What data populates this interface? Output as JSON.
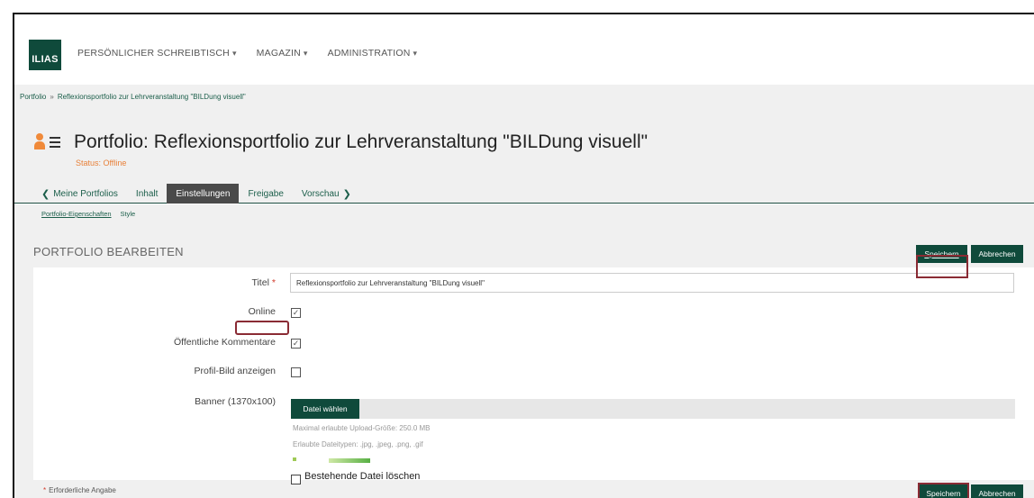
{
  "app": {
    "logo_text": "ILIAS"
  },
  "mainnav": {
    "items": [
      {
        "label": "PERSÖNLICHER SCHREIBTISCH",
        "caret": "▾"
      },
      {
        "label": "MAGAZIN",
        "caret": "▾"
      },
      {
        "label": "ADMINISTRATION",
        "caret": "▾"
      }
    ]
  },
  "breadcrumb": {
    "items": [
      "Portfolio",
      "Reflexionsportfolio zur Lehrveranstaltung \"BILDung visuell\""
    ],
    "separator": "»"
  },
  "header": {
    "title": "Portfolio: Reflexionsportfolio zur Lehrveranstaltung \"BILDung visuell\"",
    "status": "Status: Offline",
    "icon": "portfolio-icon"
  },
  "tabs": {
    "back_label": "Meine Portfolios",
    "items": [
      "Inhalt",
      "Einstellungen",
      "Freigabe"
    ],
    "active": "Einstellungen",
    "forward_label": "Vorschau"
  },
  "subtabs": {
    "items": [
      "Portfolio-Eigenschaften",
      "Style"
    ],
    "active": "Portfolio-Eigenschaften"
  },
  "form": {
    "heading": "PORTFOLIO BEARBEITEN",
    "save_label": "Speichern",
    "cancel_label": "Abbrechen",
    "fields": {
      "title_label": "Titel",
      "title_required_mark": "*",
      "title_value": "Reflexionsportfolio zur Lehrveranstaltung \"BILDung visuell\"",
      "online_label": "Online",
      "online_checked": true,
      "comments_label": "Öffentliche Kommentare",
      "comments_checked": true,
      "profile_pic_label": "Profil-Bild anzeigen",
      "profile_pic_checked": false,
      "banner_label": "Banner (1370x100)",
      "file_button_label": "Datei wählen",
      "max_upload_hint": "Maximal erlaubte Upload-Größe: 250.0 MB",
      "allowed_types_hint": "Erlaubte Dateitypen: .jpg, .jpeg, .png, .gif",
      "delete_file_label": "Bestehende Datei löschen",
      "delete_file_checked": false
    },
    "required_note": "Erforderliche Angabe",
    "required_mark": "*"
  },
  "colors": {
    "accent": "#0f4a3b",
    "status": "#e8813a",
    "highlight_box": "#8a2b34",
    "required": "#d23b2b"
  }
}
